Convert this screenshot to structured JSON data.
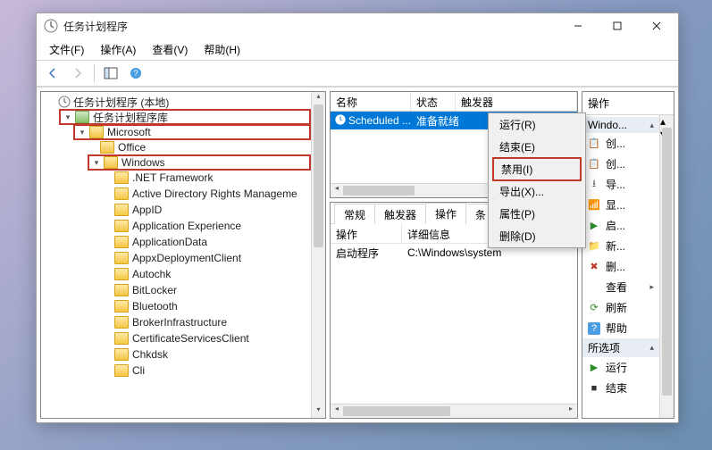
{
  "window": {
    "title": "任务计划程序"
  },
  "menu": {
    "file": "文件(F)",
    "action": "操作(A)",
    "view": "查看(V)",
    "help": "帮助(H)"
  },
  "tree": {
    "root": "任务计划程序 (本地)",
    "library": "任务计划程序库",
    "microsoft": "Microsoft",
    "office": "Office",
    "windows": "Windows",
    "children": [
      ".NET Framework",
      "Active Directory Rights Manageme",
      "AppID",
      "Application Experience",
      "ApplicationData",
      "AppxDeploymentClient",
      "Autochk",
      "BitLocker",
      "Bluetooth",
      "BrokerInfrastructure",
      "CertificateServicesClient",
      "Chkdsk",
      "Cli"
    ]
  },
  "list": {
    "cols": {
      "name": "名称",
      "status": "状态",
      "trigger": "触发器"
    },
    "row": {
      "name": "Scheduled ...",
      "status": "准备就绪"
    }
  },
  "tabs": {
    "general": "常规",
    "triggers": "触发器",
    "actions": "操作",
    "cond": "条"
  },
  "detail": {
    "cols": {
      "action": "操作",
      "info": "详细信息"
    },
    "row": {
      "action": "启动程序",
      "info": "C:\\Windows\\system"
    }
  },
  "actions": {
    "title": "操作",
    "group1": "Windo...",
    "items1": [
      "创...",
      "创...",
      "导...",
      "显...",
      "启...",
      "新...",
      "删..."
    ],
    "view": "查看",
    "refresh": "刷新",
    "help": "帮助",
    "group2": "所选项",
    "items2": [
      "运行",
      "结束"
    ]
  },
  "context": {
    "run": "运行(R)",
    "end": "结束(E)",
    "disable": "禁用(I)",
    "export": "导出(X)...",
    "properties": "属性(P)",
    "delete": "删除(D)"
  }
}
